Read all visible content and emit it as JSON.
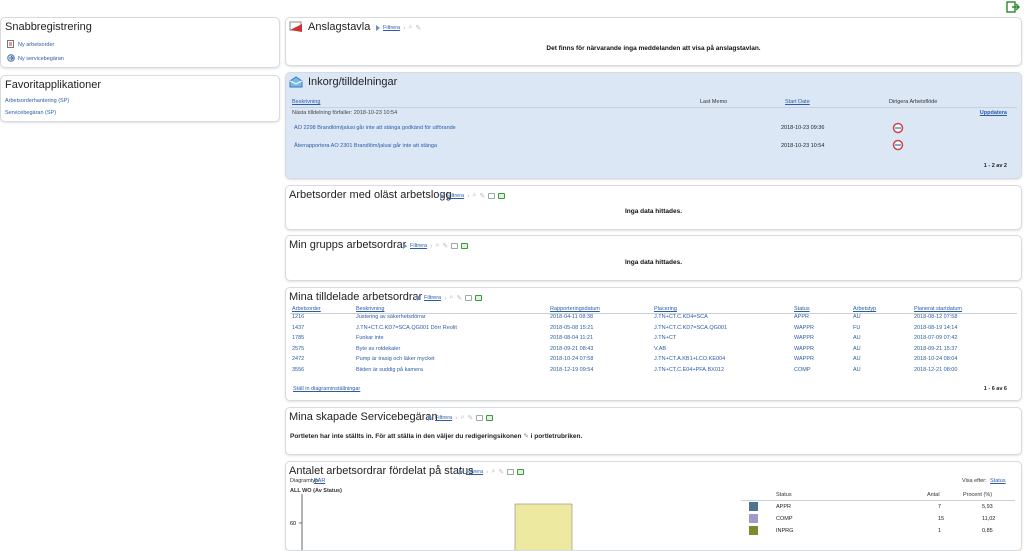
{
  "quick": {
    "title": "Snabbregistrering",
    "items": [
      {
        "label": "Ny arbetsorder"
      },
      {
        "label": "Ny servicebegäran"
      }
    ]
  },
  "favorites": {
    "title": "Favoritapplikationer",
    "items": [
      {
        "label": "Arbetsorderhantering (SP)"
      },
      {
        "label": "Servicebegäran (SP)"
      }
    ]
  },
  "bulletin": {
    "title": "Anslagstavla",
    "filter": "Filtrera",
    "message": "Det finns för närvarande inga meddelanden att visa på anslagstavlan."
  },
  "inbox": {
    "title": "Inkorg/tilldelningar",
    "cols": {
      "desc": "Beskrivning",
      "memo": "Last Memo",
      "start": "Start Date",
      "route": "Dirigera Arbetsflöde"
    },
    "next": "Nästa tilldelning förfaller: 2018-10-23 10:54",
    "update": "Uppdatera",
    "rows": [
      {
        "desc": "AO 2298 Brandlöm/jalusi går inte att stänga godkänd för utförande",
        "start": "2018-10-23 09:36"
      },
      {
        "desc": "Återrapportera AO 2301 Brandlöm/jalusi går inte att stänga",
        "start": "2018-10-23 10:54"
      }
    ],
    "footer": "1 - 2 av 2"
  },
  "unread": {
    "title": "Arbetsorder med oläst arbetslogg",
    "filter": "Filtrera",
    "message": "Inga data hittades."
  },
  "group": {
    "title": "Min grupps arbetsordrar",
    "filter": "Filtrera",
    "message": "Inga data hittades."
  },
  "assigned": {
    "title": "Mina tilldelade arbetsordrar",
    "filter": "Filtrera",
    "cols": [
      "Arbetsorder",
      "Beskrivning",
      "Rapporteringsdatum",
      "Placering",
      "Status",
      "Arbetstyp",
      "Planerat startdatum"
    ],
    "rows": [
      [
        "1216",
        "Justering av säkerhetsdörrar",
        "2018-04-11 08:38",
        "J.TN+CT.C.KD4=SCA",
        "APPR",
        "AU",
        "2018-08-12 07:58"
      ],
      [
        "1437",
        "J.TN+CT.C.KD7=SCA.QG001 Dörr Reolit",
        "2018-05-08 15:21",
        "J.TN+CT.C.KD7=SCA.QG001",
        "WAPPR",
        "FU",
        "2018-08-19 14:14"
      ],
      [
        "1785",
        "Funkar inte",
        "2018-08-04 11:21",
        "J.TN+CT",
        "WAPPR",
        "AU",
        "2018-07-09 07:42"
      ],
      [
        "2575",
        "Byte av rotdekaler",
        "2018-09-21 08:43",
        "V.AB",
        "WAPPR",
        "AU",
        "2018-09-21 15:37"
      ],
      [
        "2472",
        "Pump är trasig och läker mycket",
        "2018-10-24 07:58",
        "J.TN+CT.A.KB1+LCO.KE004",
        "WAPPR",
        "AU",
        "2018-10-24 08:04"
      ],
      [
        "3556",
        "Biiden är suddig på kamera",
        "2018-12-19 09:54",
        "J.TN+CT.C.E04+PFA.BX012",
        "COMP",
        "AU",
        "2018-12-21 08:00"
      ]
    ],
    "chartlink": "Ställ in diagraminställningar",
    "footer": "1 - 6 av 6"
  },
  "service": {
    "title": "Mina skapade Servicebegäran",
    "filter": "Filtrera",
    "message": "Portleten har inte ställts in. För att ställa in den väljer du redigeringsikonen",
    "message2": "i portletrubriken."
  },
  "chartp": {
    "title": "Antalet arbetsordrar fördelat på status",
    "filter": "Filtrera",
    "typelbl": "Diagramtyp:",
    "typeval": "BAR",
    "viewlbl": "Visa efter:",
    "viewval": "Status",
    "charttitle": "ALL WO (Av Status)",
    "tick": "60",
    "legcols": {
      "status": "Status",
      "count": "Antal",
      "pct": "Procent (%)"
    }
  },
  "chart_data": {
    "type": "bar",
    "title": "ALL WO (Av Status)",
    "categories": [
      "APPR",
      "COMP",
      "INPRG"
    ],
    "values": [
      7,
      15,
      1
    ],
    "percents": [
      "5,93",
      "11,02",
      "0,85"
    ],
    "colors": [
      "#4e7391",
      "#a49ac8",
      "#7a8c2c"
    ],
    "bar_color": "#eee9a0"
  }
}
